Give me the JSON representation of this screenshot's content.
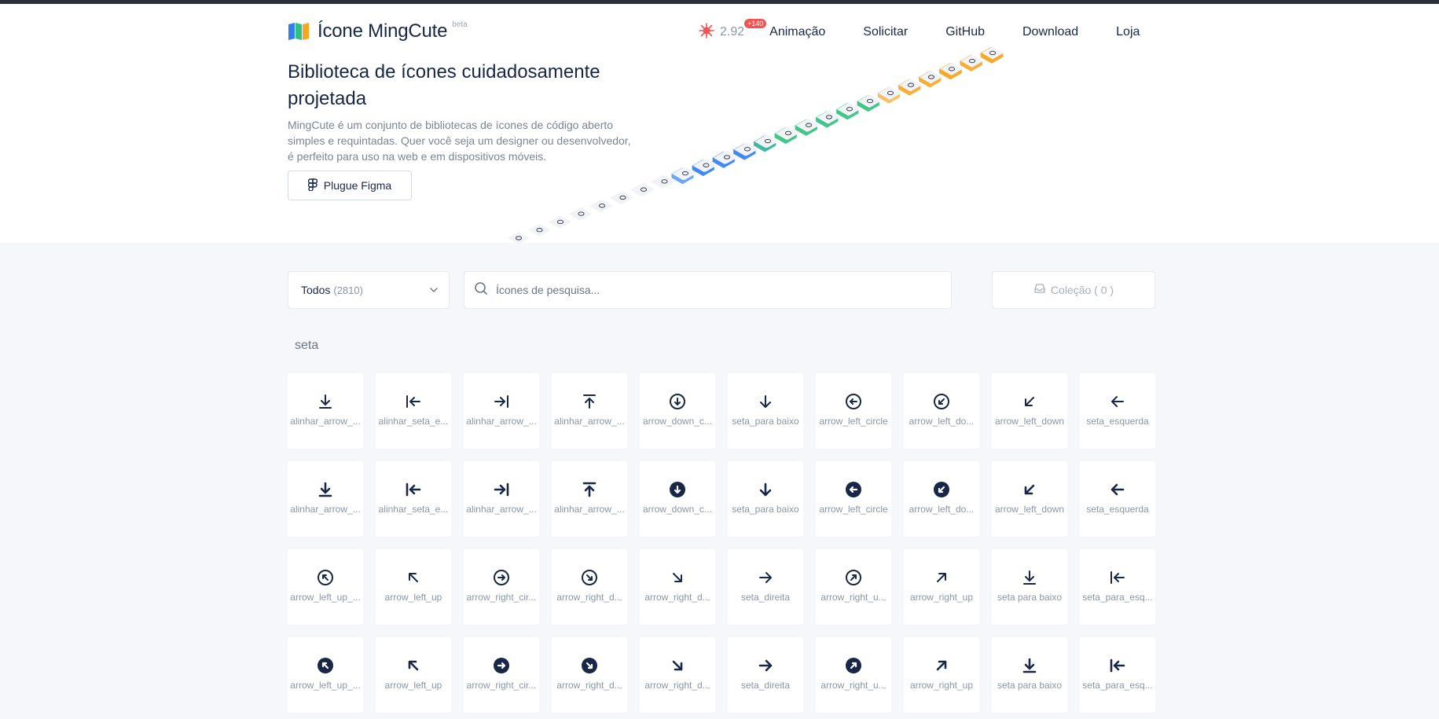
{
  "brand": {
    "name": "Ícone MingCute",
    "beta": "beta"
  },
  "nav": {
    "version": "2.92",
    "version_badge": "+140",
    "links": [
      "Animação",
      "Solicitar",
      "GitHub",
      "Download",
      "Loja"
    ]
  },
  "hero": {
    "title": "Biblioteca de ícones cuidadosamente projetada",
    "description": "MingCute é um conjunto de bibliotecas de ícones de código aberto simples e requintadas. Quer você seja um designer ou desenvolvedor, é perfeito para uso na web e em dispositivos móveis.",
    "figma_button": "Plugue Figma"
  },
  "filter": {
    "label": "Todos",
    "count": "(2810)"
  },
  "search": {
    "placeholder": "Ícones de pesquisa...",
    "value": ""
  },
  "collection": {
    "label": "Coleção ( 0 )"
  },
  "section": {
    "title": "seta"
  },
  "colors": {
    "text": "#182746",
    "muted": "#8c96a4",
    "blue": "#2f7ff2",
    "green": "#2ec27e",
    "orange": "#f7a623",
    "badge": "#f25454"
  },
  "icons": [
    {
      "label": "alinhar_arrow_...",
      "icon": "align-arrow-down-icon"
    },
    {
      "label": "alinhar_seta_e...",
      "icon": "align-arrow-left-icon"
    },
    {
      "label": "alinhar_arrow_...",
      "icon": "align-arrow-right-icon"
    },
    {
      "label": "alinhar_arrow_...",
      "icon": "align-arrow-up-icon"
    },
    {
      "label": "arrow_down_c...",
      "icon": "arrow-down-circle-icon"
    },
    {
      "label": "seta_para baixo",
      "icon": "arrow-down-icon"
    },
    {
      "label": "arrow_left_circle",
      "icon": "arrow-left-circle-icon"
    },
    {
      "label": "arrow_left_do...",
      "icon": "arrow-left-down-circle-icon"
    },
    {
      "label": "arrow_left_down",
      "icon": "arrow-left-down-icon"
    },
    {
      "label": "seta_esquerda",
      "icon": "arrow-left-icon"
    },
    {
      "label": "alinhar_arrow_...",
      "icon": "align-arrow-down-fill-icon"
    },
    {
      "label": "alinhar_seta_e...",
      "icon": "align-arrow-left-fill-icon"
    },
    {
      "label": "alinhar_arrow_...",
      "icon": "align-arrow-right-fill-icon"
    },
    {
      "label": "alinhar_arrow_...",
      "icon": "align-arrow-up-fill-icon"
    },
    {
      "label": "arrow_down_c...",
      "icon": "arrow-down-circle-fill-icon"
    },
    {
      "label": "seta_para baixo",
      "icon": "arrow-down-fill-icon"
    },
    {
      "label": "arrow_left_circle",
      "icon": "arrow-left-circle-fill-icon"
    },
    {
      "label": "arrow_left_do...",
      "icon": "arrow-left-down-circle-fill-icon"
    },
    {
      "label": "arrow_left_down",
      "icon": "arrow-left-down-fill-icon"
    },
    {
      "label": "seta_esquerda",
      "icon": "arrow-left-fill-icon"
    },
    {
      "label": "arrow_left_up_...",
      "icon": "arrow-left-up-circle-icon"
    },
    {
      "label": "arrow_left_up",
      "icon": "arrow-left-up-icon"
    },
    {
      "label": "arrow_right_cir...",
      "icon": "arrow-right-circle-icon"
    },
    {
      "label": "arrow_right_d...",
      "icon": "arrow-right-down-circle-icon"
    },
    {
      "label": "arrow_right_d...",
      "icon": "arrow-right-down-icon"
    },
    {
      "label": "seta_direita",
      "icon": "arrow-right-icon"
    },
    {
      "label": "arrow_right_u...",
      "icon": "arrow-right-up-circle-icon"
    },
    {
      "label": "arrow_right_up",
      "icon": "arrow-right-up-icon"
    },
    {
      "label": "seta para baixo",
      "icon": "arrow-to-down-icon"
    },
    {
      "label": "seta_para_esq...",
      "icon": "arrow-to-left-icon"
    },
    {
      "label": "arrow_left_up_...",
      "icon": "arrow-left-up-circle-fill-icon"
    },
    {
      "label": "arrow_left_up",
      "icon": "arrow-left-up-fill-icon"
    },
    {
      "label": "arrow_right_cir...",
      "icon": "arrow-right-circle-fill-icon"
    },
    {
      "label": "arrow_right_d...",
      "icon": "arrow-right-down-circle-fill-icon"
    },
    {
      "label": "arrow_right_d...",
      "icon": "arrow-right-down-fill-icon"
    },
    {
      "label": "seta_direita",
      "icon": "arrow-right-fill-icon"
    },
    {
      "label": "arrow_right_u...",
      "icon": "arrow-right-up-circle-fill-icon"
    },
    {
      "label": "arrow_right_up",
      "icon": "arrow-right-up-fill-icon"
    },
    {
      "label": "seta para baixo",
      "icon": "arrow-to-down-fill-icon"
    },
    {
      "label": "seta_para_esq...",
      "icon": "arrow-to-left-fill-icon"
    }
  ]
}
